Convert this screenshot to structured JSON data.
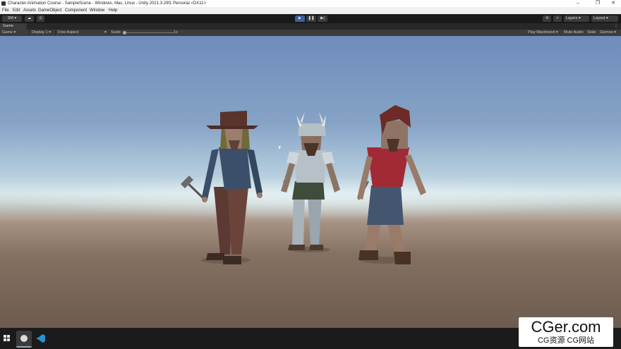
{
  "window": {
    "title": "Character Animation Course - SampleScene - Windows, Mac, Linux - Unity 2021.3.29f1 Personal <DX11>",
    "minimize": "–",
    "maximize": "❐",
    "close": "✕"
  },
  "menu": [
    "File",
    "Edit",
    "Assets",
    "GameObject",
    "Component",
    "Window",
    "Help"
  ],
  "toolbar": {
    "account": "SM",
    "layers": "Layers",
    "layout": "Layout"
  },
  "tab": {
    "label": "Game"
  },
  "game_toolbar": {
    "mode": "Game",
    "display": "Display 1",
    "aspect": "Free Aspect",
    "scale_label": "Scale",
    "scale_value": "1x",
    "play_focused": "Play Maximized",
    "mute_audio": "Mute Audio",
    "stats": "Stats",
    "gizmos": "Gizmos"
  },
  "scene": {
    "characters": [
      "adventurer-with-hat",
      "viking-in-armor",
      "warrior-red-shirt"
    ]
  },
  "watermark": {
    "main": "CGer.com",
    "sub": "CG资源 CG网站"
  },
  "colors": {
    "accent": "#3d5fa0",
    "sky_top": "#6f8cbb",
    "ground": "#6d5b4f"
  }
}
